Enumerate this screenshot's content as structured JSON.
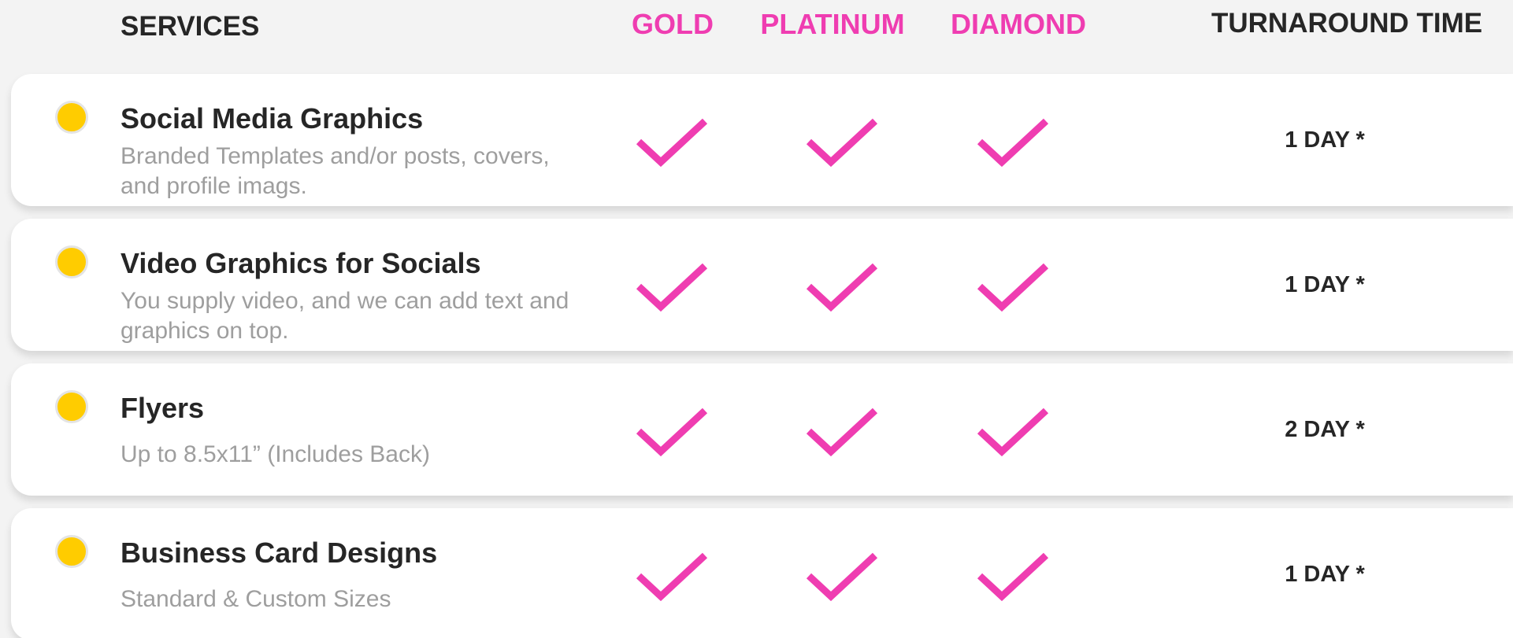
{
  "header": {
    "services_label": "SERVICES",
    "gold_label": "GOLD",
    "platinum_label": "PLATINUM",
    "diamond_label": "DIAMOND",
    "turnaround_label": "TURNAROUND TIME"
  },
  "colors": {
    "accent_pink": "#ef3db1",
    "bullet_yellow": "#ffcc00",
    "row_background": "#ffffff",
    "page_background": "#f3f3f3"
  },
  "rows": [
    {
      "title": "Social Media Graphics",
      "description": "Branded Templates and/or posts, covers, and profile imags.",
      "gold": true,
      "platinum": true,
      "diamond": true,
      "turnaround": "1 DAY *"
    },
    {
      "title": "Video Graphics for Socials",
      "description": "You supply video, and we can add text and graphics on top.",
      "gold": true,
      "platinum": true,
      "diamond": true,
      "turnaround": "1 DAY *"
    },
    {
      "title": "Flyers",
      "description": "Up to 8.5x11” (Includes Back)",
      "gold": true,
      "platinum": true,
      "diamond": true,
      "turnaround": "2 DAY *"
    },
    {
      "title": "Business Card Designs",
      "description": "Standard & Custom Sizes",
      "gold": true,
      "platinum": true,
      "diamond": true,
      "turnaround": "1 DAY *"
    }
  ]
}
